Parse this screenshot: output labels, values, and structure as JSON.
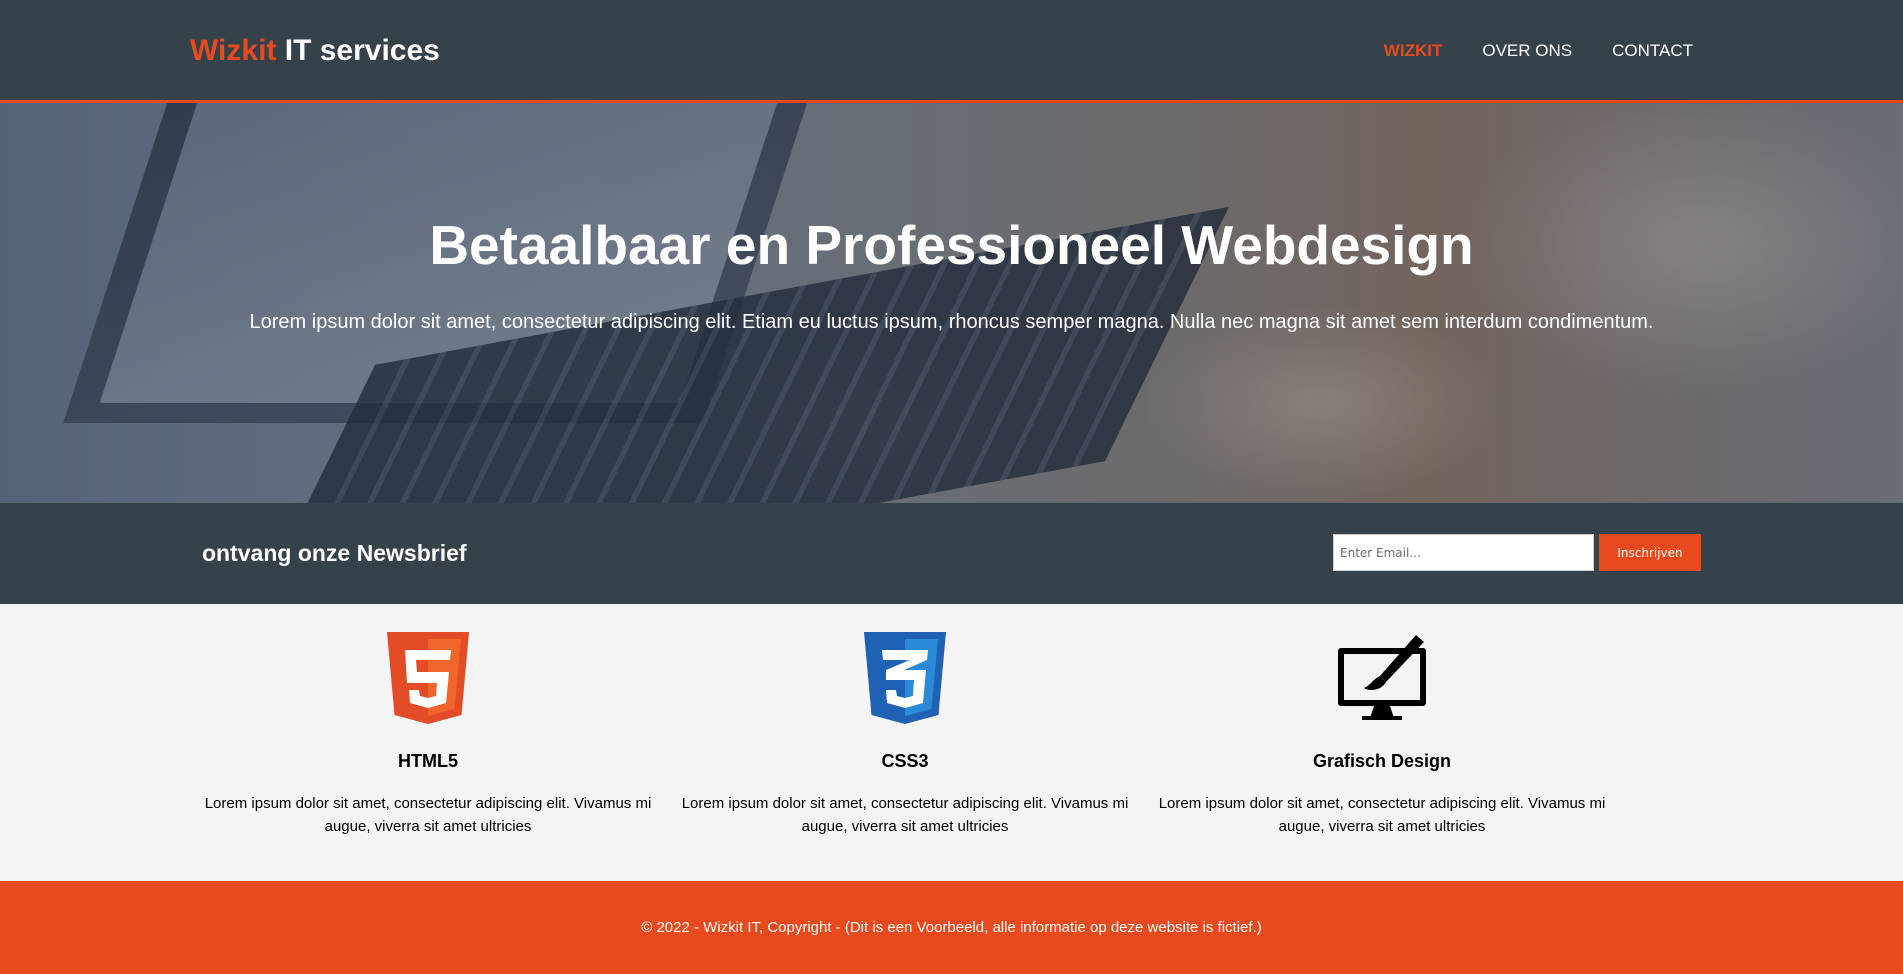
{
  "header": {
    "logo_accent": "Wizkit",
    "logo_rest": " IT services",
    "nav": [
      {
        "label": "WIZKIT"
      },
      {
        "label": "OVER ONS"
      },
      {
        "label": "CONTACT"
      }
    ]
  },
  "hero": {
    "title": "Betaalbaar en Professioneel Webdesign",
    "subtitle": "Lorem ipsum dolor sit amet, consectetur adipiscing elit. Etiam eu luctus ipsum, rhoncus semper magna. Nulla nec magna sit amet sem interdum condimentum."
  },
  "newsletter": {
    "heading": "ontvang onze Newsbrief",
    "email_placeholder": "Enter Email...",
    "email_value": "",
    "button_label": "Inschrijven"
  },
  "boxes": [
    {
      "icon": "html5-logo-icon",
      "title": "HTML5",
      "text": "Lorem ipsum dolor sit amet, consectetur adipiscing elit. Vivamus mi augue, viverra sit amet ultricies"
    },
    {
      "icon": "css3-logo-icon",
      "title": "CSS3",
      "text": "Lorem ipsum dolor sit amet, consectetur adipiscing elit. Vivamus mi augue, viverra sit amet ultricies"
    },
    {
      "icon": "monitor-brush-icon",
      "title": "Grafisch Design",
      "text": "Lorem ipsum dolor sit amet, consectetur adipiscing elit. Vivamus mi augue, viverra sit amet ultricies"
    }
  ],
  "footer": {
    "text": "© 2022 - Wizkit IT, Copyright - (Dit is een Voorbeeld, alle informatie op deze website is fictief.)"
  },
  "colors": {
    "header_bg": "#35424a",
    "accent": "#e8491d",
    "boxes_bg": "#f4f4f4",
    "css3_blue": "#1f62b4"
  }
}
